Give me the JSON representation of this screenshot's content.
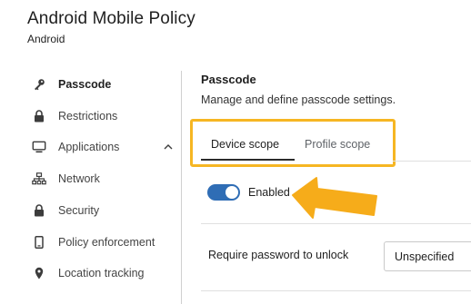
{
  "header": {
    "title": "Android Mobile Policy",
    "subtitle": "Android"
  },
  "sidebar": {
    "items": [
      {
        "label": "Passcode",
        "icon": "key-icon",
        "active": true
      },
      {
        "label": "Restrictions",
        "icon": "lock-icon"
      },
      {
        "label": "Applications",
        "icon": "monitor-icon",
        "expandable": true
      },
      {
        "label": "Network",
        "icon": "network-icon"
      },
      {
        "label": "Security",
        "icon": "lock-icon"
      },
      {
        "label": "Policy enforcement",
        "icon": "phone-icon"
      },
      {
        "label": "Location tracking",
        "icon": "location-pin-icon"
      }
    ]
  },
  "main": {
    "title": "Passcode",
    "description": "Manage and define passcode settings.",
    "tabs": [
      {
        "label": "Device scope",
        "selected": true
      },
      {
        "label": "Profile scope",
        "selected": false
      }
    ],
    "toggle": {
      "label": "Enabled",
      "on": true
    },
    "password": {
      "label": "Require password to unlock",
      "value": "Unspecified"
    }
  },
  "colors": {
    "accent": "#2f6db5",
    "highlight": "#f6b623",
    "arrow": "#f6ac1a"
  }
}
